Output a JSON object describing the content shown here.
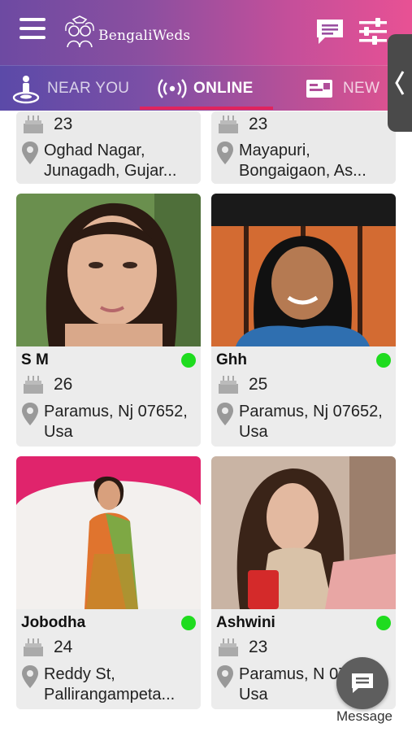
{
  "app": {
    "brand": "BengaliWeds"
  },
  "tabs": [
    {
      "label": "NEAR YOU"
    },
    {
      "label": "ONLINE"
    },
    {
      "label": "NEW"
    }
  ],
  "profiles_top": [
    {
      "age": "23",
      "location": "Oghad Nagar, Junagadh, Gujar..."
    },
    {
      "age": "23",
      "location": "Mayapuri, Bongaigaon, As..."
    }
  ],
  "profiles": [
    {
      "name": "S M",
      "age": "26",
      "location": "Paramus, Nj 07652, Usa"
    },
    {
      "name": "Ghh",
      "age": "25",
      "location": "Paramus, Nj 07652, Usa"
    },
    {
      "name": "Jobodha",
      "age": "24",
      "location": "Reddy St, Pallirangampeta..."
    },
    {
      "name": "Ashwini",
      "age": "23",
      "location": "Paramus, N 07652, Usa"
    }
  ],
  "fab": {
    "label": "Message"
  },
  "colors": {
    "online": "#1fdc1f",
    "accent": "#e0245e"
  }
}
